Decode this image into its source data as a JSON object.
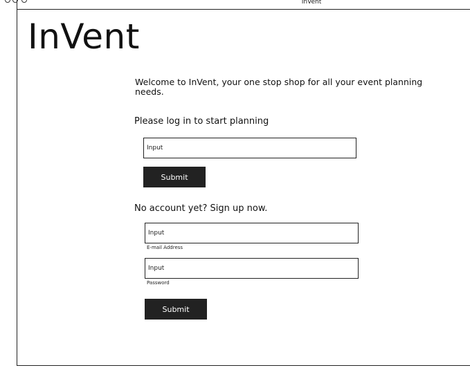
{
  "window": {
    "title": "InVent"
  },
  "app": {
    "title": "InVent",
    "welcome_text": "Welcome to InVent, your one stop shop for all your event planning needs."
  },
  "login": {
    "heading": "Please log in to start planning",
    "input_placeholder": "Input",
    "submit_label": "Submit"
  },
  "signup": {
    "heading": "No account yet? Sign up now.",
    "email_placeholder": "Input",
    "email_caption": "E-mail Address",
    "password_placeholder": "Input",
    "password_caption": "Password",
    "submit_label": "Submit"
  }
}
